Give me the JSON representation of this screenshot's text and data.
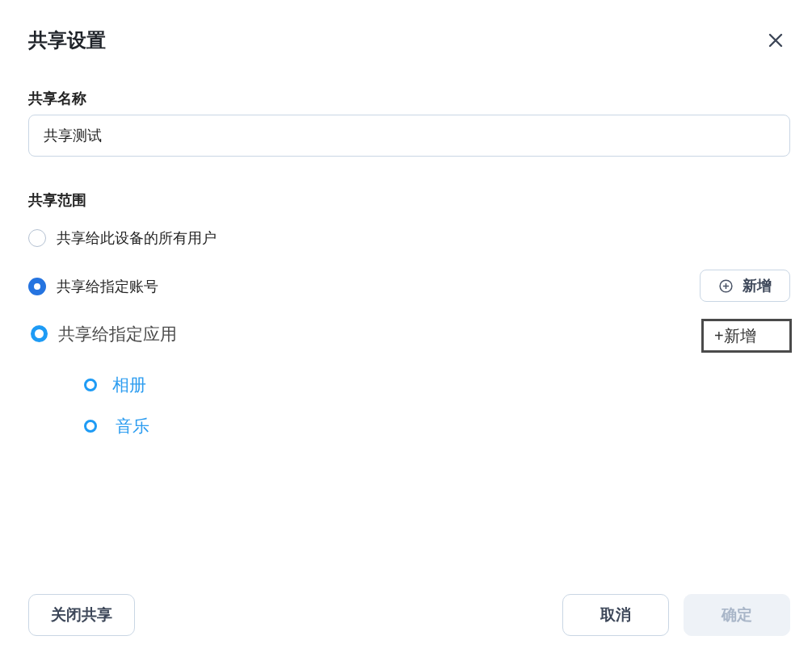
{
  "dialog": {
    "title": "共享设置"
  },
  "name_field": {
    "label": "共享名称",
    "value": "共享测试"
  },
  "scope": {
    "label": "共享范围",
    "options": [
      {
        "kind": "styled",
        "label": "共享给此设备的所有用户",
        "selected": false
      },
      {
        "kind": "styled",
        "label": "共享给指定账号",
        "selected": true,
        "add_button": "新增"
      },
      {
        "kind": "native",
        "label": "共享给指定应用",
        "selected": true,
        "add_button": "+新增",
        "children": [
          {
            "label": "相册"
          },
          {
            "label": "音乐"
          }
        ]
      }
    ]
  },
  "footer": {
    "left_button": {
      "label": "关闭共享"
    },
    "right_buttons": [
      {
        "label": "取消",
        "disabled": false
      },
      {
        "label": "确定",
        "disabled": true
      }
    ]
  }
}
